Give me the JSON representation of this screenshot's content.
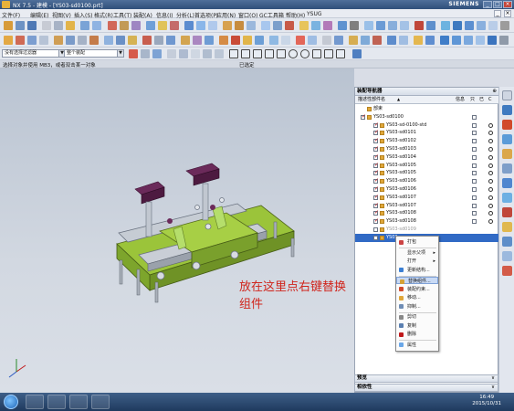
{
  "window": {
    "title": "NX 7.5 - 建模 - [YS03-sd0100.prt]",
    "brand": "SIEMENS",
    "min": "_",
    "max": "□",
    "close": "×"
  },
  "menu": {
    "items": [
      "文件(F)",
      "编辑(E)",
      "视图(V)",
      "插入(S)",
      "格式(R)",
      "工具(T)",
      "装配(A)",
      "信息(I)",
      "分析(L)",
      "首选项(P)",
      "应用(N)",
      "窗口(O)",
      "GC工具箱",
      "帮助(H)",
      "YSUG"
    ]
  },
  "filters": {
    "selection": "没有选择过滤器",
    "scope": "整个装配"
  },
  "cue": {
    "prompt": "选择对象并使用 MB3，或者双击某一对象",
    "status": "已选定"
  },
  "navigator": {
    "title": "装配导航器",
    "pin": "⊕",
    "col_name": "描述性部件名",
    "sort_arrow": "▲",
    "col_info": "信息",
    "col_r": "只",
    "col_m": "已",
    "col_c": "C",
    "rows": [
      {
        "label": "部束",
        "indent": 1,
        "check": "none",
        "c1": false,
        "c2": false
      },
      {
        "label": "YS03-sd0100",
        "indent": 1,
        "check": "on",
        "c1": true,
        "c2": false
      },
      {
        "label": "YS03-sd-0100-std",
        "indent": 2,
        "check": "on",
        "c1": true,
        "c2": true
      },
      {
        "label": "YS03-sd0101",
        "indent": 2,
        "check": "on",
        "c1": true,
        "c2": true
      },
      {
        "label": "YS03-sd0102",
        "indent": 2,
        "check": "on",
        "c1": true,
        "c2": true
      },
      {
        "label": "YS03-sd0103",
        "indent": 2,
        "check": "on",
        "c1": true,
        "c2": true
      },
      {
        "label": "YS03-sd0104",
        "indent": 2,
        "check": "on",
        "c1": true,
        "c2": true
      },
      {
        "label": "YS03-sd0105",
        "indent": 2,
        "check": "on",
        "c1": true,
        "c2": true
      },
      {
        "label": "YS03-sd0105",
        "indent": 2,
        "check": "on",
        "c1": true,
        "c2": true
      },
      {
        "label": "YS03-sd0106",
        "indent": 2,
        "check": "on",
        "c1": true,
        "c2": true
      },
      {
        "label": "YS03-sd0106",
        "indent": 2,
        "check": "on",
        "c1": true,
        "c2": true
      },
      {
        "label": "YS03-sd0107",
        "indent": 2,
        "check": "on",
        "c1": true,
        "c2": true
      },
      {
        "label": "YS03-sd0107",
        "indent": 2,
        "check": "on",
        "c1": true,
        "c2": true
      },
      {
        "label": "YS03-sd0108",
        "indent": 2,
        "check": "on",
        "c1": true,
        "c2": true
      },
      {
        "label": "YS03-sd0108",
        "indent": 2,
        "check": "on",
        "c1": true,
        "c2": true
      },
      {
        "label": "YS03-sd0109",
        "indent": 2,
        "check": "off",
        "c1": false,
        "c2": false,
        "grey": true
      },
      {
        "label": "YS03",
        "indent": 2,
        "check": "off",
        "c1": false,
        "c2": false,
        "selected": true
      }
    ]
  },
  "sections": {
    "preview": "预览",
    "dependencies": "相依性",
    "arrow": "∨"
  },
  "context_menu": {
    "items": [
      {
        "label": "打包",
        "icon_color": "#c44",
        "submenu": false,
        "highlight": false
      },
      {
        "label": "显示父项",
        "icon_color": "",
        "submenu": true,
        "highlight": false
      },
      {
        "label": "打开",
        "icon_color": "",
        "submenu": true,
        "highlight": false
      },
      {
        "label": "更新结构...",
        "icon_color": "#3b7fd3",
        "submenu": false,
        "highlight": false
      },
      {
        "label": "替换组件...",
        "icon_color": "#d5a236",
        "submenu": false,
        "highlight": true
      },
      {
        "label": "装配约束...",
        "icon_color": "#d14a2a",
        "submenu": false,
        "highlight": false
      },
      {
        "label": "移动...",
        "icon_color": "#e0a73a",
        "submenu": false,
        "highlight": false
      },
      {
        "label": "抑制...",
        "icon_color": "#6f8db5",
        "submenu": false,
        "highlight": false
      },
      {
        "label": "剪切",
        "icon_color": "#888",
        "submenu": false,
        "highlight": false
      },
      {
        "label": "复制",
        "icon_color": "#5a7fb0",
        "submenu": false,
        "highlight": false
      },
      {
        "label": "删除",
        "icon_color": "#c0191b",
        "submenu": false,
        "highlight": false
      },
      {
        "label": "属性",
        "icon_color": "#6aa7e8",
        "submenu": false,
        "highlight": false
      }
    ]
  },
  "annotation": "放在这里点右键替换组件",
  "taskbar": {
    "time": "16:49",
    "date": "2015/10/31"
  },
  "colors": {
    "selection_blue": "#316ac5",
    "annotation_red": "#d0251c",
    "fixture_green": "#9bc43a",
    "pin_purple": "#6b2a5a"
  }
}
